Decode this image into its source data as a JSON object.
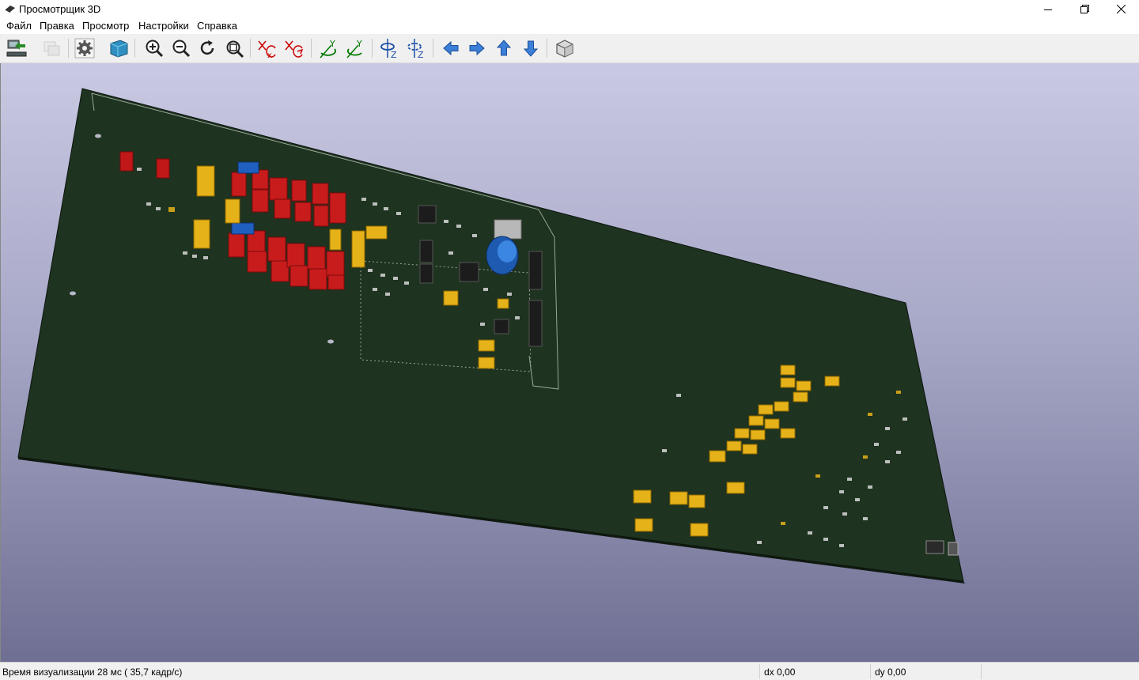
{
  "window": {
    "title": "Просмотрщик 3D",
    "controls": [
      "minimize-icon",
      "restore-icon",
      "close-icon"
    ]
  },
  "menu": {
    "items": [
      {
        "label": "Файл"
      },
      {
        "label": "Правка"
      },
      {
        "label": "Просмотр"
      },
      {
        "label": "Настройки"
      },
      {
        "label": "Справка"
      }
    ]
  },
  "toolbar": {
    "buttons": [
      {
        "icon": "reload-board-icon",
        "enabled": true
      },
      {
        "icon": "copy-image-icon",
        "enabled": false
      },
      {
        "icon": "settings-gear-icon",
        "enabled": true
      },
      {
        "icon": "raytrace-cube-icon",
        "enabled": true
      },
      {
        "icon": "zoom-in-icon",
        "enabled": true
      },
      {
        "icon": "zoom-out-icon",
        "enabled": true
      },
      {
        "icon": "redraw-icon",
        "enabled": true
      },
      {
        "icon": "zoom-fit-icon",
        "enabled": true
      },
      {
        "icon": "rotate-x-cw-icon",
        "enabled": true
      },
      {
        "icon": "rotate-x-ccw-icon",
        "enabled": true
      },
      {
        "icon": "rotate-y-cw-icon",
        "enabled": true
      },
      {
        "icon": "rotate-y-ccw-icon",
        "enabled": true
      },
      {
        "icon": "rotate-z-cw-icon",
        "enabled": true
      },
      {
        "icon": "rotate-z-ccw-icon",
        "enabled": true
      },
      {
        "icon": "move-left-icon",
        "enabled": true
      },
      {
        "icon": "move-right-icon",
        "enabled": true
      },
      {
        "icon": "move-up-icon",
        "enabled": true
      },
      {
        "icon": "move-down-icon",
        "enabled": true
      },
      {
        "icon": "orthographic-cube-icon",
        "enabled": true
      }
    ]
  },
  "viewport": {
    "background_top": "#c9c9e3",
    "background_bottom": "#6f6f93",
    "board_color": "#1e3320"
  },
  "status": {
    "render_time": "Время визуализации 28 мс ( 35,7 кадр/с)",
    "dx": "dx 0,00",
    "dy": "dy 0,00"
  }
}
